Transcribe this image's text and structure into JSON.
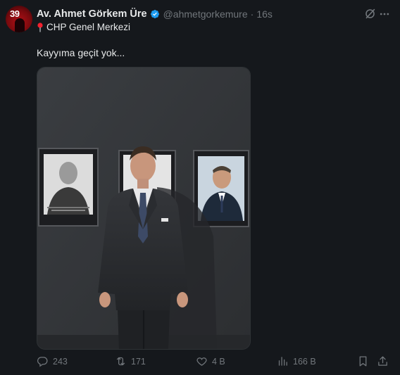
{
  "author": {
    "display_name": "Av. Ahmet Görkem Üre",
    "handle": "@ahmetgorkemure",
    "separator": "·",
    "time": "16s",
    "location": "CHP Genel Merkezi",
    "avatar_badge": "39"
  },
  "tweet": {
    "text": "Kayyıma geçit yok..."
  },
  "icons": {
    "verified": "verified-badge-icon",
    "grok": "grok-icon",
    "more": "more-icon",
    "location": "pin-icon"
  },
  "actions": {
    "reply_count": "243",
    "retweet_count": "171",
    "like_count": "4 B",
    "view_count": "166 B"
  },
  "colors": {
    "background": "#15181c",
    "text": "#e7e9ea",
    "muted": "#71767b",
    "verified": "#1d9bf0",
    "pin": "#f4212e"
  }
}
